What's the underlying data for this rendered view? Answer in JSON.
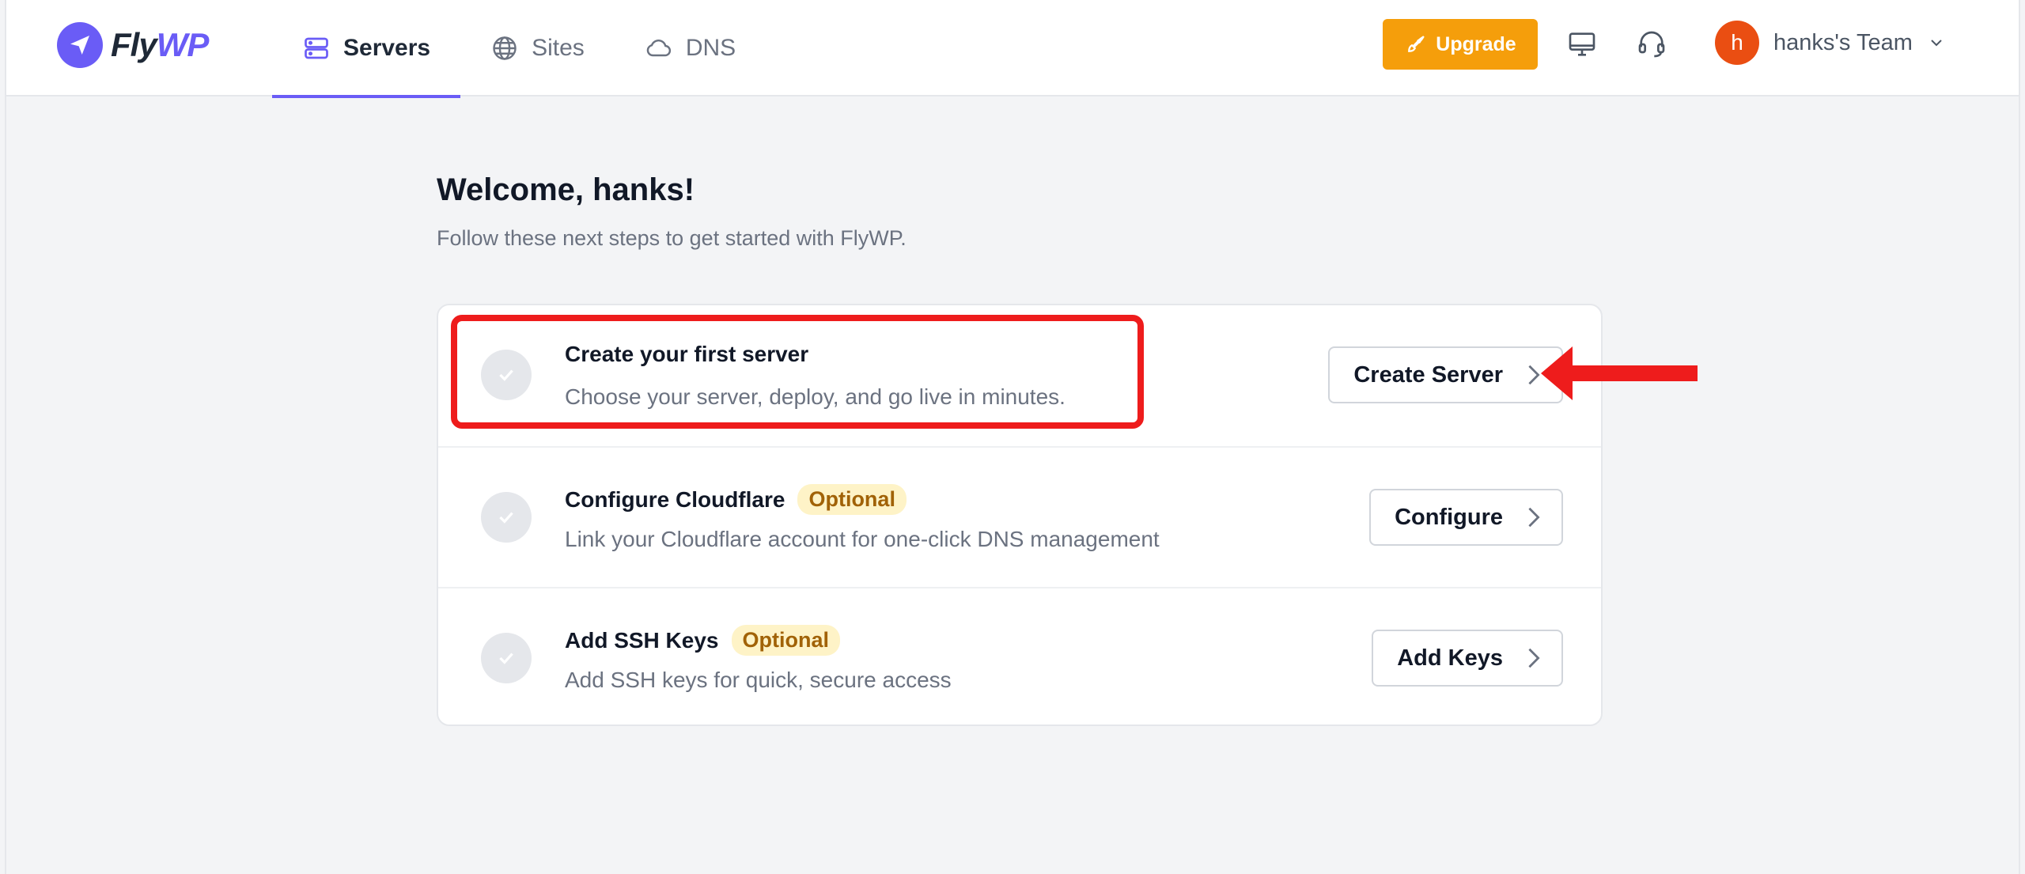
{
  "brand": {
    "name_fly": "Fly",
    "name_wp": "WP",
    "logo_color": "#6a5cf6"
  },
  "nav": {
    "items": [
      {
        "label": "Servers",
        "icon": "server-icon",
        "active": true
      },
      {
        "label": "Sites",
        "icon": "globe-icon",
        "active": false
      },
      {
        "label": "DNS",
        "icon": "cloud-icon",
        "active": false
      }
    ]
  },
  "header": {
    "upgrade_label": "Upgrade",
    "upgrade_color": "#f59e0b",
    "monitor_icon": "monitor-icon",
    "support_icon": "headset-icon",
    "team": {
      "avatar_letter": "h",
      "name": "hanks's Team",
      "avatar_color": "#ea4e12"
    }
  },
  "main": {
    "title": "Welcome, hanks!",
    "subtitle": "Follow these next steps to get started with FlyWP.",
    "steps": [
      {
        "title": "Create your first server",
        "badge": "",
        "description": "Choose your server, deploy, and go live in minutes.",
        "button": "Create Server"
      },
      {
        "title": "Configure Cloudflare",
        "badge": "Optional",
        "description": "Link your Cloudflare account for one-click DNS management",
        "button": "Configure"
      },
      {
        "title": "Add SSH Keys",
        "badge": "Optional",
        "description": "Add SSH keys for quick, secure access",
        "button": "Add Keys"
      }
    ]
  },
  "annotation": {
    "highlight_color": "#ee1c1c"
  }
}
